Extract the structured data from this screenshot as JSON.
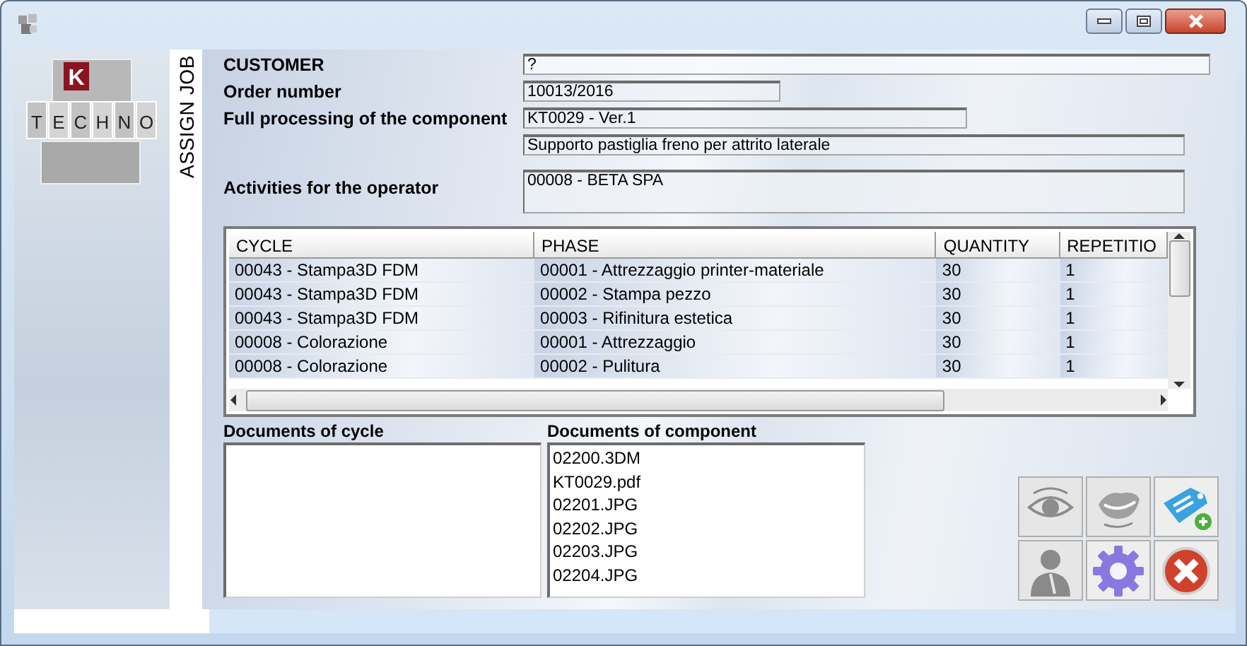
{
  "logo": {
    "mark": "K",
    "letters": [
      "T",
      "E",
      "C",
      "H",
      "N",
      "O"
    ]
  },
  "side_title": "ASSIGN JOB",
  "fields": [
    {
      "label": "CUSTOMER",
      "value": "?"
    },
    {
      "label": "Order number",
      "value": "10013/2016"
    },
    {
      "label": "Full processing of the component",
      "value": "KT0029 - Ver.1"
    },
    {
      "value": "Supporto pastiglia freno per attrito laterale"
    },
    {
      "label": "Activities for the operator",
      "value": "00008 - BETA SPA",
      "kind": "multiline"
    }
  ],
  "table": {
    "columns": [
      "CYCLE",
      "PHASE",
      "QUANTITY",
      "REPETITIO"
    ],
    "rows": [
      [
        "00043 - Stampa3D FDM",
        "00001 - Attrezzaggio printer-materiale",
        "30",
        "1"
      ],
      [
        "00043 - Stampa3D FDM",
        "00002 - Stampa pezzo",
        "30",
        "1"
      ],
      [
        "00043 - Stampa3D FDM",
        "00003 - Rifinitura estetica",
        "30",
        "1"
      ],
      [
        "00008 - Colorazione",
        "00001 - Attrezzaggio",
        "30",
        "1"
      ],
      [
        "00008 - Colorazione",
        "00002 - Pulitura",
        "30",
        "1"
      ]
    ]
  },
  "documents_of_cycle": {
    "label": "Documents of cycle"
  },
  "documents_of_component": {
    "label": "Documents of component",
    "items": [
      "02200.3DM",
      "KT0029.pdf",
      "02201.JPG",
      "02202.JPG",
      "02203.JPG",
      "02204.JPG"
    ]
  },
  "buttons": [
    {
      "kind": "eye",
      "disabled": true
    },
    {
      "kind": "mouth",
      "disabled": true
    },
    {
      "kind": "tag-add",
      "disabled": false
    },
    {
      "kind": "person",
      "disabled": true
    },
    {
      "kind": "gear",
      "disabled": false
    },
    {
      "kind": "close",
      "disabled": false
    }
  ]
}
